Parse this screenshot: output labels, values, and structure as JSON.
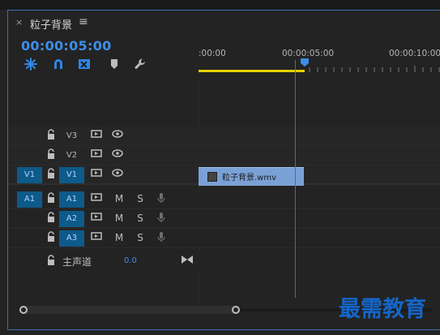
{
  "panel": {
    "close_label": "×",
    "title": "粒子背景",
    "menu_label": "≡"
  },
  "timecode": "00:00:05:00",
  "toolbar": [
    {
      "icon": "snap-icon"
    },
    {
      "icon": "magnet-icon"
    },
    {
      "icon": "linked-selection-icon"
    },
    {
      "icon": "marker-icon"
    },
    {
      "icon": "wrench-icon"
    }
  ],
  "ruler": {
    "labels": [
      ":00:00",
      "00:00:05:00",
      "00:00:10:00"
    ]
  },
  "tracks": {
    "video": [
      {
        "target": "",
        "label": "V3",
        "target_on": false,
        "label_on": false
      },
      {
        "target": "",
        "label": "V2",
        "target_on": false,
        "label_on": false
      },
      {
        "target": "V1",
        "label": "V1",
        "target_on": true,
        "label_on": true
      }
    ],
    "audio": [
      {
        "target": "A1",
        "label": "A1",
        "target_on": true,
        "label_on": true,
        "m": "M",
        "s": "S"
      },
      {
        "target": "",
        "label": "A2",
        "target_on": false,
        "label_on": true,
        "m": "M",
        "s": "S"
      },
      {
        "target": "",
        "label": "A3",
        "target_on": false,
        "label_on": true,
        "m": "M",
        "s": "S"
      }
    ],
    "master": {
      "label": "主声道",
      "value": "0.0"
    }
  },
  "clip": {
    "name": "粒子背景.wmv"
  },
  "watermark": "最需教育",
  "colors": {
    "accent": "#3d8ee9",
    "clip": "#7aa1d6",
    "inout": "#e6d000",
    "target_on": "#0e5a8a"
  }
}
